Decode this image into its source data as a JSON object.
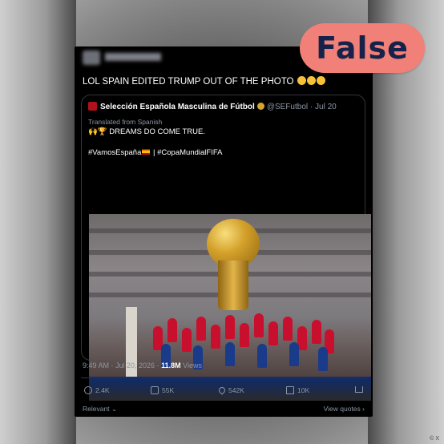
{
  "verdict": "False",
  "post": {
    "text": "LOL SPAIN EDITED TRUMP OUT OF THE PHOTO"
  },
  "quoted": {
    "name": "Selección Española Masculina de Fútbol",
    "handle": "@SEFutbol",
    "date": "· Jul 20",
    "translated": "Translated from Spanish",
    "text": "DREAMS DO COME TRUE.",
    "tags_a": "#VamosEspaña",
    "tags_b": "| #CopaMundialFIFA"
  },
  "meta": {
    "time": "9:49 AM · Jul 20, 2026 ·",
    "views_count": "11.8M",
    "views_label": "Views"
  },
  "actions": {
    "reply": "2.4K",
    "repost": "55K",
    "like": "542K",
    "bookmark": "10K"
  },
  "footer": {
    "relevant": "Relevant",
    "view_quotes": "View quotes"
  },
  "credit": "© X"
}
